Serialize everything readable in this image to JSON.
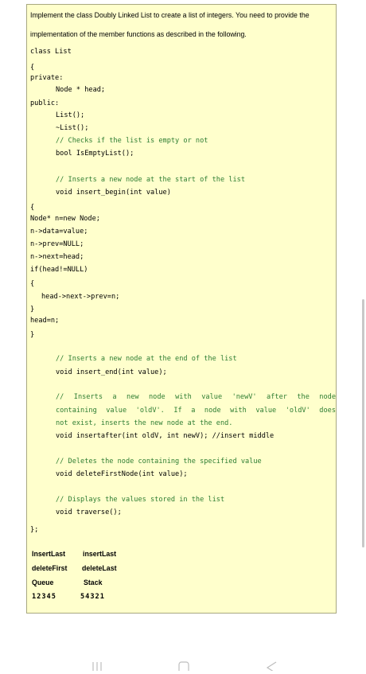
{
  "document": {
    "intro_line_1": "Implement the class Doubly Linked List to create a list of integers. You need to provide the",
    "intro_line_2": "implementation of the member functions as described in the following.",
    "code": {
      "class_decl": "class List",
      "open_brace": "{",
      "private_label": "private:",
      "head_decl": "Node * head;",
      "public_label": "public:",
      "ctor": "List();",
      "dtor": "~List();",
      "empty_comment": "// Checks if the list is empty or not",
      "empty_decl": "bool IsEmptyList();",
      "insert_begin_comment": "// Inserts a new node at the start of the list",
      "insert_begin_decl": "void insert_begin(int value)",
      "impl_open": "{",
      "impl_node_new": "Node* n=new Node;",
      "impl_data": "n->data=value;",
      "impl_prev": "n->prev=NULL;",
      "impl_next": "n->next=head;",
      "impl_if": "if(head!=NULL)",
      "impl_if_open": "{",
      "impl_head_prev": "head->next->prev=n;",
      "impl_if_close": "}",
      "impl_head_assign": "head=n;",
      "impl_close": "}",
      "insert_end_comment": "// Inserts a new node at the end of the list",
      "insert_end_decl": "void insert_end(int value);",
      "insertafter_comment_1": "// Inserts a new node with value 'newV' after the node",
      "insertafter_comment_2": "containing value 'oldV'. If a node with value 'oldV' does",
      "insertafter_comment_3": "not exist, inserts the new node at the end.",
      "insertafter_decl": "void insertafter(int oldV, int newV); //insert middle",
      "delete_comment": "// Deletes the node containing the specified value",
      "delete_decl": "void deleteFirstNode(int value);",
      "traverse_comment": "// Displays the values stored in the list",
      "traverse_decl": "void traverse();",
      "class_close": "};"
    },
    "ops": {
      "insert_last_a": "InsertLast",
      "insert_last_b": "insertLast",
      "delete_first": "deleteFirst",
      "delete_last": "deleteLast",
      "queue": "Queue",
      "stack": "Stack",
      "queue_output": "12345",
      "stack_output": "54321"
    }
  },
  "navigation": {
    "recents_icon": "recents-icon",
    "home_icon": "home-icon",
    "back_icon": "back-icon"
  }
}
